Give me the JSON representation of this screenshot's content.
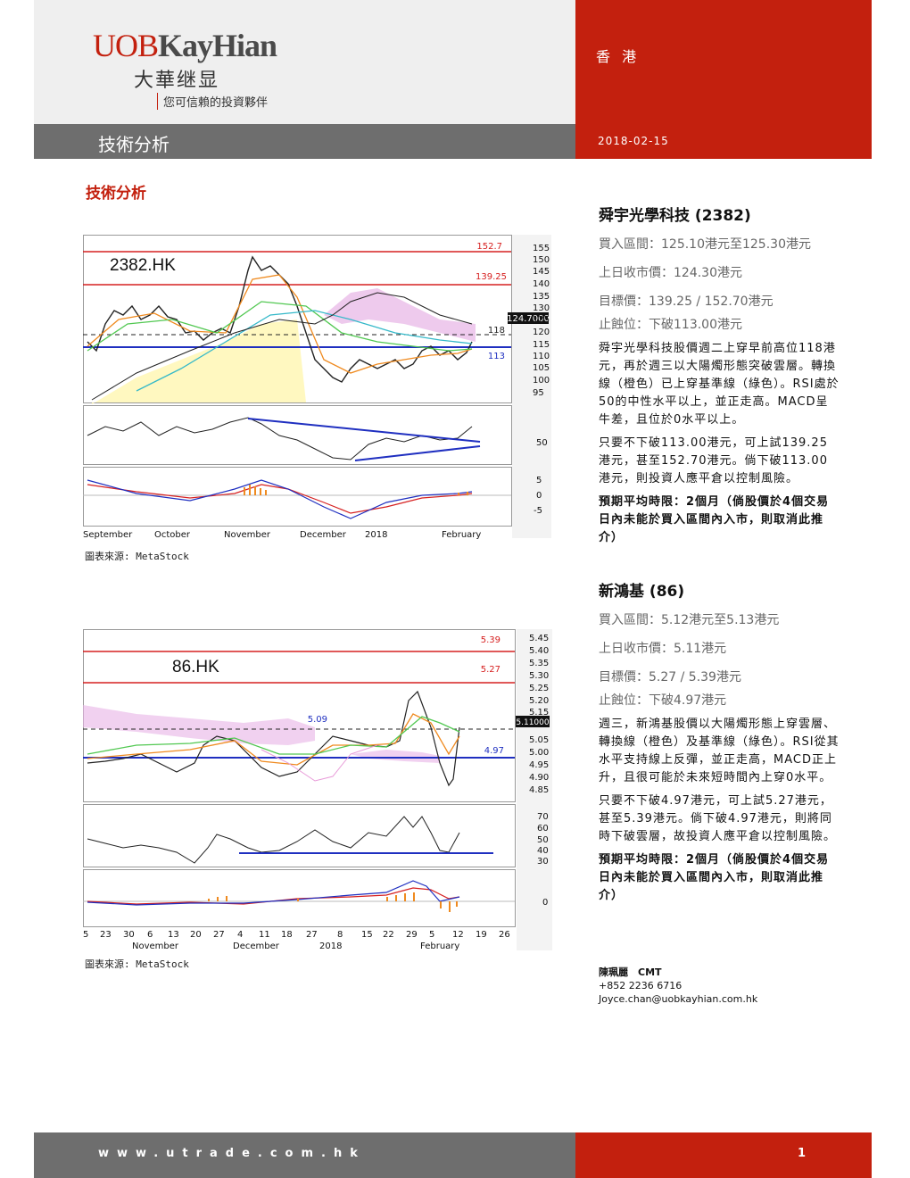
{
  "header": {
    "logo_uob": "UOB",
    "logo_kayhian": "KayHian",
    "logo_chinese": "大華继显",
    "tagline": "您可信賴的投資夥伴",
    "region": "香 港",
    "section_title": "技術分析",
    "date": "2018-02-15"
  },
  "subtitle": "技術分析",
  "colors": {
    "brand_red": "#c3200e",
    "bar_grey": "#6e6e6e",
    "header_grey": "#efefef"
  },
  "charts": [
    {
      "ticker": "2382.HK",
      "price_ticks": [
        "155",
        "150",
        "145",
        "140",
        "135",
        "130",
        "125",
        "120",
        "115",
        "110",
        "105",
        "100",
        "95"
      ],
      "levels": [
        "152.7",
        "139.25",
        "118",
        "113"
      ],
      "last_price": "124.7000",
      "rsi_ticks": [
        "50"
      ],
      "macd_ticks": [
        "5",
        "0",
        "-5"
      ],
      "months": [
        "September",
        "October",
        "November",
        "December",
        "2018",
        "February"
      ],
      "source": "圖表來源: MetaStock"
    },
    {
      "ticker": "86.HK",
      "price_ticks": [
        "5.45",
        "5.40",
        "5.35",
        "5.30",
        "5.25",
        "5.20",
        "5.15",
        "5.05",
        "5.00",
        "4.95",
        "4.90",
        "4.85"
      ],
      "levels": [
        "5.39",
        "5.27",
        "5.09",
        "4.97"
      ],
      "last_price": "5.11000",
      "rsi_ticks": [
        "70",
        "60",
        "50",
        "40",
        "30"
      ],
      "macd_ticks": [
        "0"
      ],
      "days": [
        "5",
        "23",
        "30",
        "6",
        "13",
        "20",
        "27",
        "4",
        "11",
        "18",
        "27",
        "8",
        "15",
        "22",
        "29",
        "5",
        "12",
        "19",
        "26"
      ],
      "months": [
        "November",
        "December",
        "2018",
        "February"
      ],
      "source": "圖表來源: MetaStock"
    }
  ],
  "stocks": [
    {
      "name": "舜宇光學科技 (2382)",
      "buy_range": "買入區間：125.10港元至125.30港元",
      "last_close": "上日收市價：124.30港元",
      "target": "目標價：139.25 / 152.70港元",
      "stop_loss": "止蝕位：下破113.00港元",
      "para1": "舜宇光學科技股價週二上穿早前高位118港元，再於週三以大陽燭形態突破雲層。轉換線（橙色）已上穿基準線（綠色）。RSI處於50的中性水平以上，並正走高。MACD呈牛差，且位於0水平以上。",
      "para2": "只要不下破113.00港元，可上試139.25港元，甚至152.70港元。倘下破113.00港元，則投資人應平倉以控制風險。",
      "para3": "預期平均時限：2個月（倘股價於4個交易日內未能於買入區間內入市，則取消此推介）"
    },
    {
      "name": "新鴻基 (86)",
      "buy_range": "買入區間：5.12港元至5.13港元",
      "last_close": "上日收市價：5.11港元",
      "target": "目標價：5.27 / 5.39港元",
      "stop_loss": "止蝕位：下破4.97港元",
      "para1": "週三，新鴻基股價以大陽燭形態上穿雲層、轉換線（橙色）及基準線（綠色）。RSI從其水平支持線上反彈，並正走高，MACD正上升，且很可能於未來短時間內上穿0水平。",
      "para2": "只要不下破4.97港元，可上試5.27港元，甚至5.39港元。倘下破4.97港元，則將同時下破雲層，故投資人應平倉以控制風險。",
      "para3": "預期平均時限：2個月（倘股價於4個交易日內未能於買入區間內入市，則取消此推介）"
    }
  ],
  "analyst": {
    "name": "陳珮麗　CMT",
    "phone": "+852 2236 6716",
    "email": "Joyce.chan@uobkayhian.com.hk"
  },
  "footer": {
    "url": "www.utrade.com.hk",
    "page": "1"
  }
}
